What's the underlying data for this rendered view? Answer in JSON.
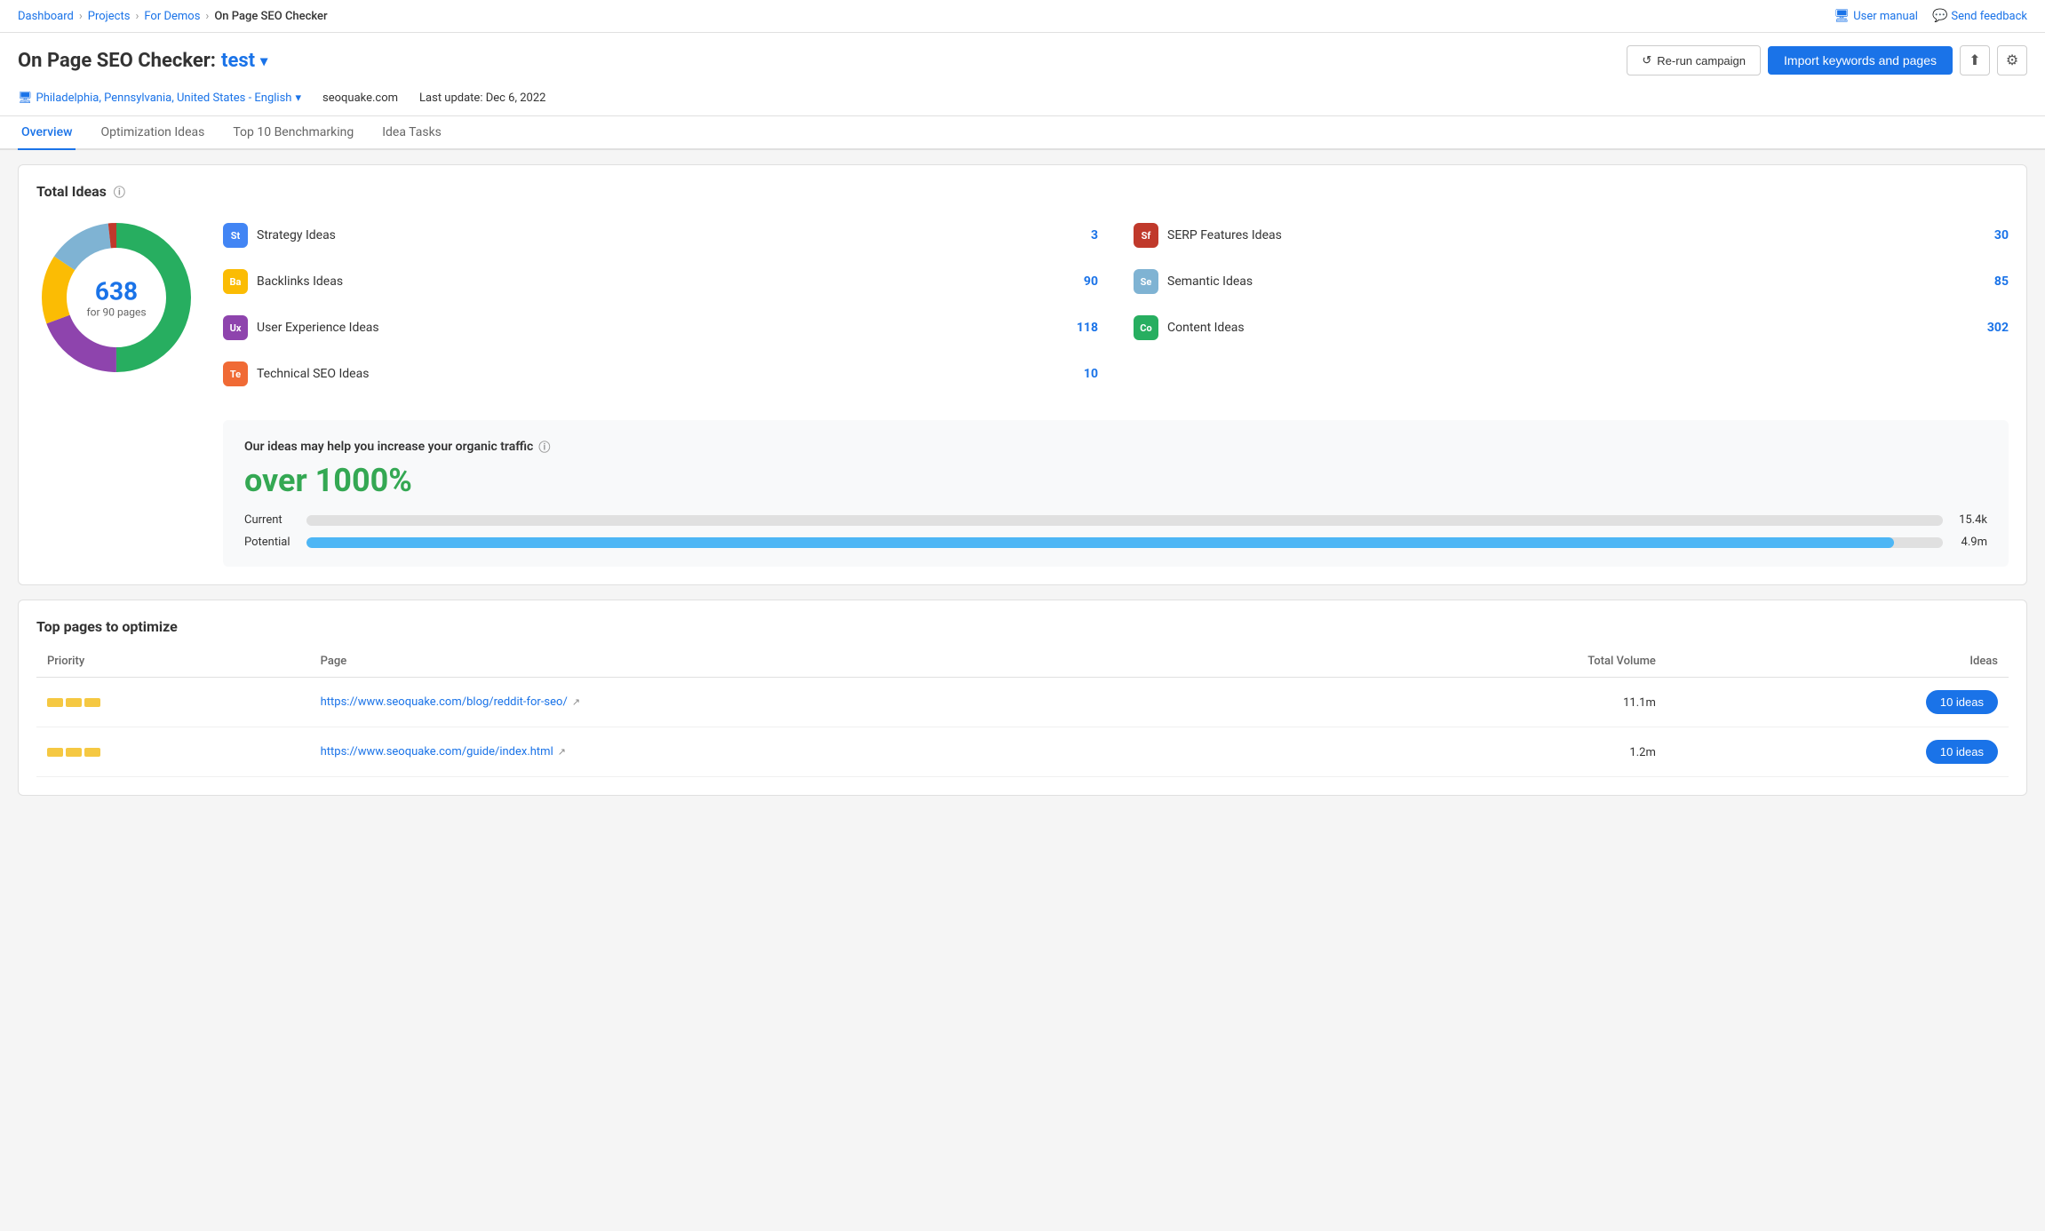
{
  "topbar": {
    "breadcrumb": [
      "Dashboard",
      "Projects",
      "For Demos",
      "On Page SEO Checker"
    ],
    "user_manual": "User manual",
    "send_feedback": "Send feedback"
  },
  "header": {
    "title_prefix": "On Page SEO Checker:",
    "project_name": "test",
    "rerun_label": "Re-run campaign",
    "import_label": "Import keywords and pages"
  },
  "subheader": {
    "location": "Philadelphia, Pennsylvania, United States - English",
    "domain": "seoquake.com",
    "last_update": "Last update: Dec 6, 2022"
  },
  "tabs": [
    {
      "label": "Overview",
      "active": true
    },
    {
      "label": "Optimization Ideas",
      "active": false
    },
    {
      "label": "Top 10 Benchmarking",
      "active": false
    },
    {
      "label": "Idea Tasks",
      "active": false
    }
  ],
  "total_ideas": {
    "title": "Total Ideas",
    "donut_number": "638",
    "donut_label": "for 90 pages",
    "ideas": [
      {
        "badge": "St",
        "name": "Strategy Ideas",
        "count": "3",
        "color": "#4285f4"
      },
      {
        "badge": "Ba",
        "name": "Backlinks Ideas",
        "count": "90",
        "color": "#fbbc04"
      },
      {
        "badge": "Ux",
        "name": "User Experience Ideas",
        "count": "118",
        "color": "#8e44ad"
      },
      {
        "badge": "Te",
        "name": "Technical SEO Ideas",
        "count": "10",
        "color": "#f06a35"
      },
      {
        "badge": "Sf",
        "name": "SERP Features Ideas",
        "count": "30",
        "color": "#c0392b"
      },
      {
        "badge": "Se",
        "name": "Semantic Ideas",
        "count": "85",
        "color": "#7fb3d3"
      },
      {
        "badge": "Co",
        "name": "Content Ideas",
        "count": "302",
        "color": "#27ae60"
      }
    ]
  },
  "traffic": {
    "title": "Our ideas may help you increase your organic traffic",
    "percent": "over 1000%",
    "current_label": "Current",
    "current_value": "15.4k",
    "potential_label": "Potential",
    "potential_value": "4.9m"
  },
  "top_pages": {
    "title": "Top pages to optimize",
    "columns": [
      "Priority",
      "Page",
      "Total Volume",
      "Ideas"
    ],
    "rows": [
      {
        "priority": 3,
        "url": "https://www.seoquake.com/blog/reddit-for-seo/",
        "volume": "11.1m",
        "ideas_label": "10 ideas"
      },
      {
        "priority": 3,
        "url": "https://www.seoquake.com/guide/index.html",
        "volume": "1.2m",
        "ideas_label": "10 ideas"
      }
    ]
  },
  "donut": {
    "segments": [
      {
        "color": "#27ae60",
        "percent": 47
      },
      {
        "color": "#8e44ad",
        "percent": 18
      },
      {
        "color": "#fbbc04",
        "percent": 14
      },
      {
        "color": "#7fb3d3",
        "percent": 13
      },
      {
        "color": "#c0392b",
        "percent": 5
      },
      {
        "color": "#f06a35",
        "percent": 2
      },
      {
        "color": "#4285f4",
        "percent": 1
      }
    ]
  }
}
